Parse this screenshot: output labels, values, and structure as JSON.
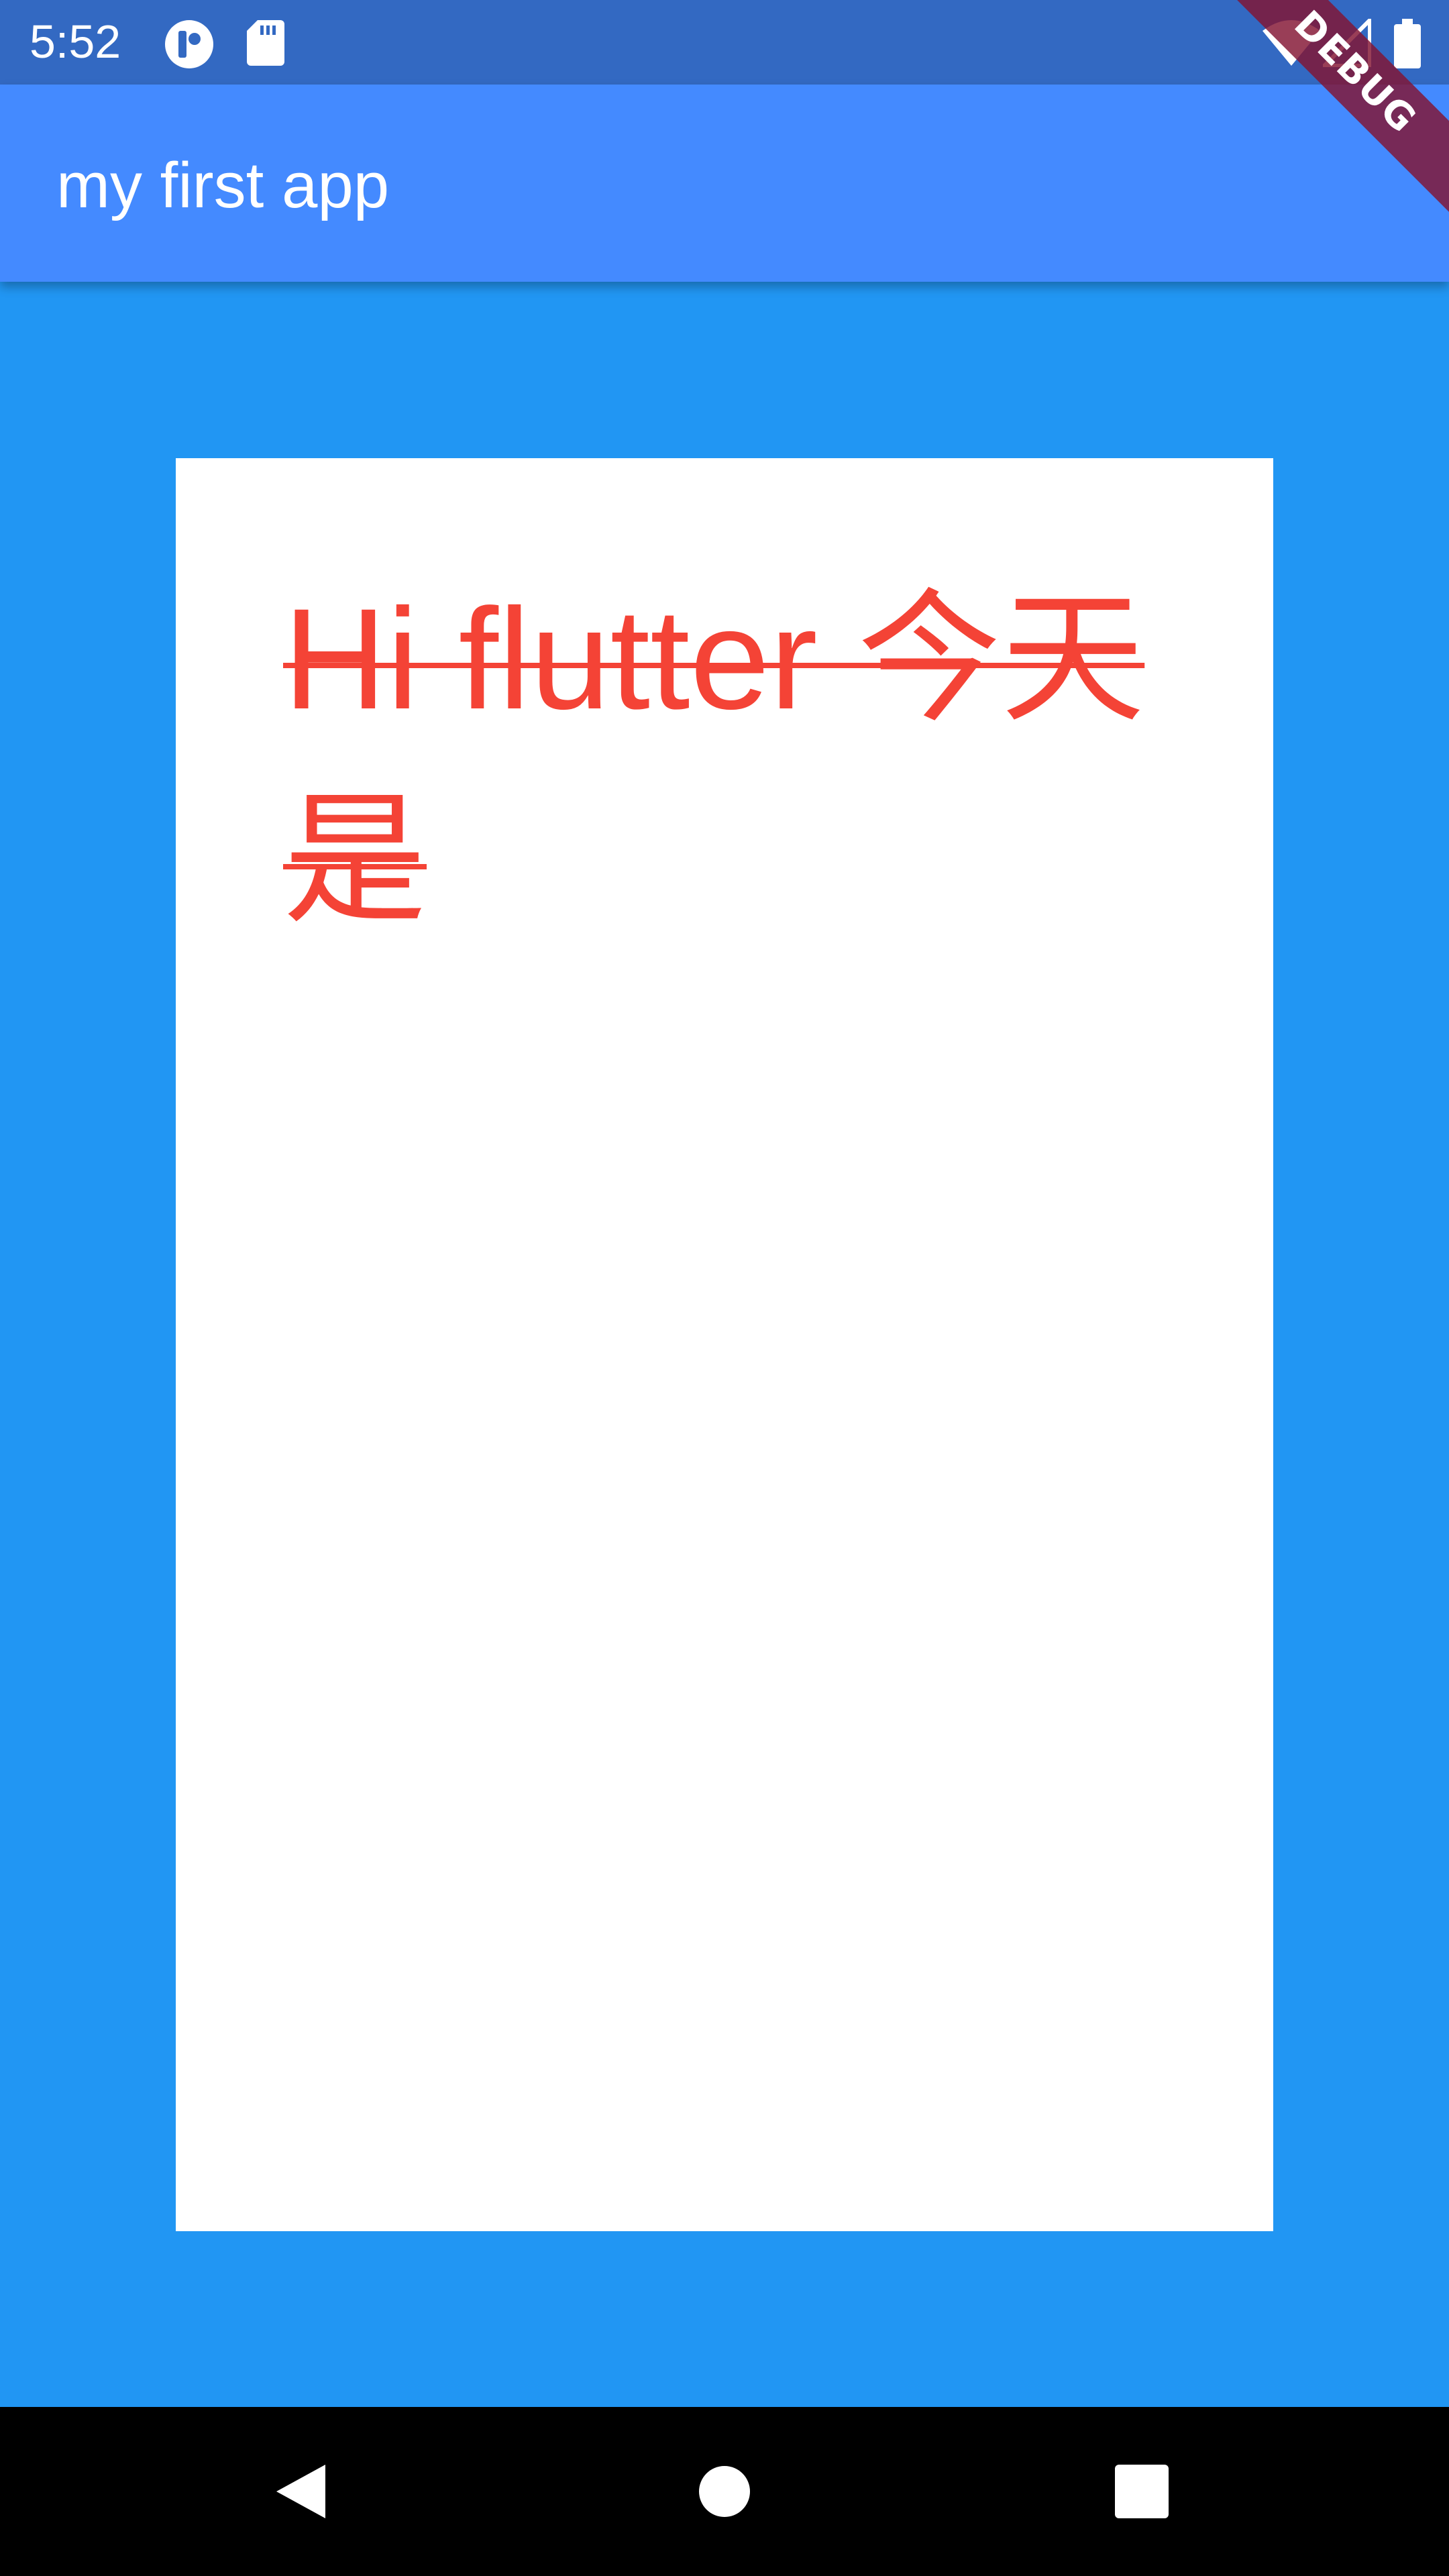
{
  "status_bar": {
    "time": "5:52",
    "icons": [
      "app-notification-icon",
      "sd-card-icon",
      "wifi-icon",
      "cell-signal-icon",
      "battery-icon"
    ]
  },
  "app_bar": {
    "title": "my first app"
  },
  "debug_banner": {
    "label": "DEBUG"
  },
  "card": {
    "text": "Hi flutter 今天是"
  },
  "nav_bar": {
    "buttons": [
      "back-icon",
      "home-icon",
      "recents-icon"
    ]
  },
  "colors": {
    "status_bar": "#3369C2",
    "app_bar": "#448AFF",
    "background": "#2196F3",
    "card": "#FFFFFF",
    "text": "#F44336",
    "nav_bar": "#000000"
  }
}
